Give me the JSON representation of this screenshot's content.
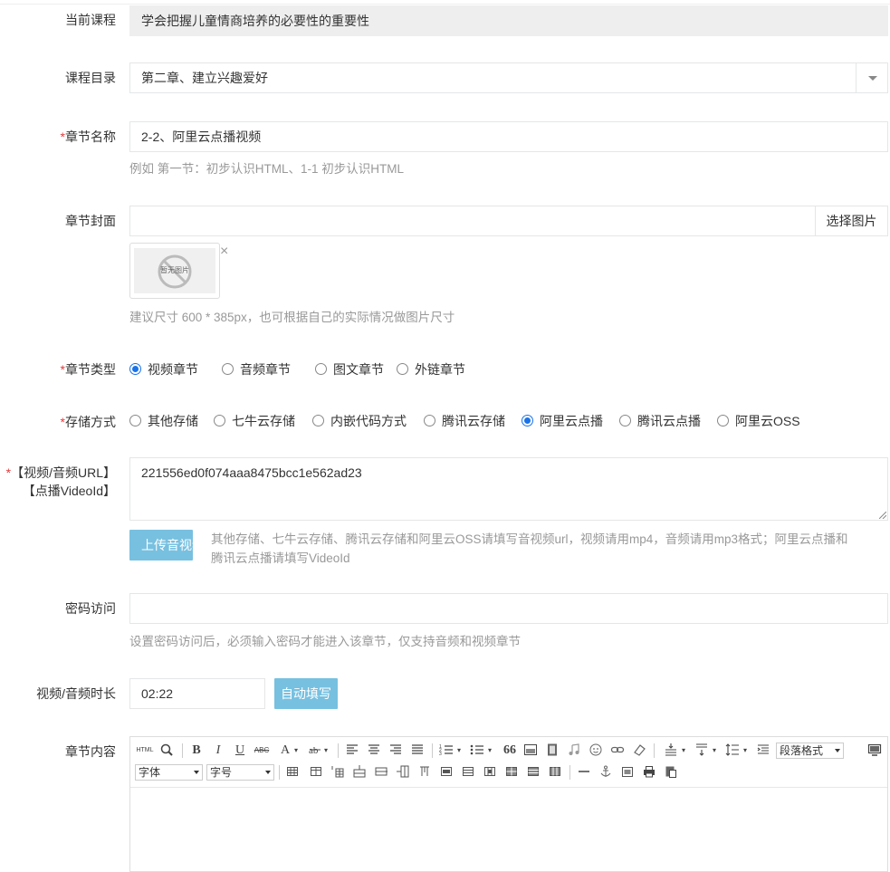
{
  "course": {
    "label": "当前课程",
    "value": "学会把握儿童情商培养的必要性的重要性"
  },
  "catalog": {
    "label": "课程目录",
    "value": "第二章、建立兴趣爱好"
  },
  "chapter_name": {
    "required_mark": "*",
    "label": "章节名称",
    "value": "2-2、阿里云点播视频",
    "help": "例如 第一节：初步认识HTML、1-1 初步认识HTML"
  },
  "cover": {
    "label": "章节封面",
    "value": "",
    "button": "选择图片",
    "thumb_text": "暂无图片",
    "close": "×",
    "help": "建议尺寸 600 * 385px，也可根据自己的实际情况做图片尺寸"
  },
  "chapter_type": {
    "required_mark": "*",
    "label": "章节类型",
    "options": [
      "视频章节",
      "音频章节",
      "图文章节",
      "外链章节"
    ],
    "selected": "视频章节"
  },
  "storage": {
    "required_mark": "*",
    "label": "存储方式",
    "options": [
      "其他存储",
      "七牛云存储",
      "内嵌代码方式",
      "腾讯云存储",
      "阿里云点播",
      "腾讯云点播",
      "阿里云OSS"
    ],
    "selected": "阿里云点播"
  },
  "media_url": {
    "required_mark": "*",
    "label_line1": "【视频/音频URL】",
    "label_line2": "【点播VideoId】",
    "value": "221556ed0f074aaa8475bcc1e562ad23",
    "upload_button": "上传音视频",
    "help_line1": "其他存储、七牛云存储、腾讯云存储和阿里云OSS请填写音视频url，视频请用mp4，音频请用mp3格式；阿里云点播和",
    "help_line2": "腾讯云点播请填写VideoId"
  },
  "password": {
    "label": "密码访问",
    "value": "",
    "help": "设置密码访问后，必须输入密码才能进入该章节，仅支持音频和视频章节"
  },
  "duration": {
    "label": "视频/音频时长",
    "value": "02:22",
    "button": "自动填写"
  },
  "content": {
    "label": "章节内容",
    "toolbar": {
      "html": "HTML",
      "bold": "B",
      "italic": "I",
      "underline": "U",
      "strike": "ABC",
      "fontcolor": "A",
      "quote": "66",
      "paragraph_select": "段落格式",
      "font_select": "字体",
      "size_select": "字号"
    }
  },
  "colors": {
    "accent": "#1a73e8",
    "required": "#e4393c",
    "button_blue": "#77c0e0",
    "help_text": "#999999"
  }
}
